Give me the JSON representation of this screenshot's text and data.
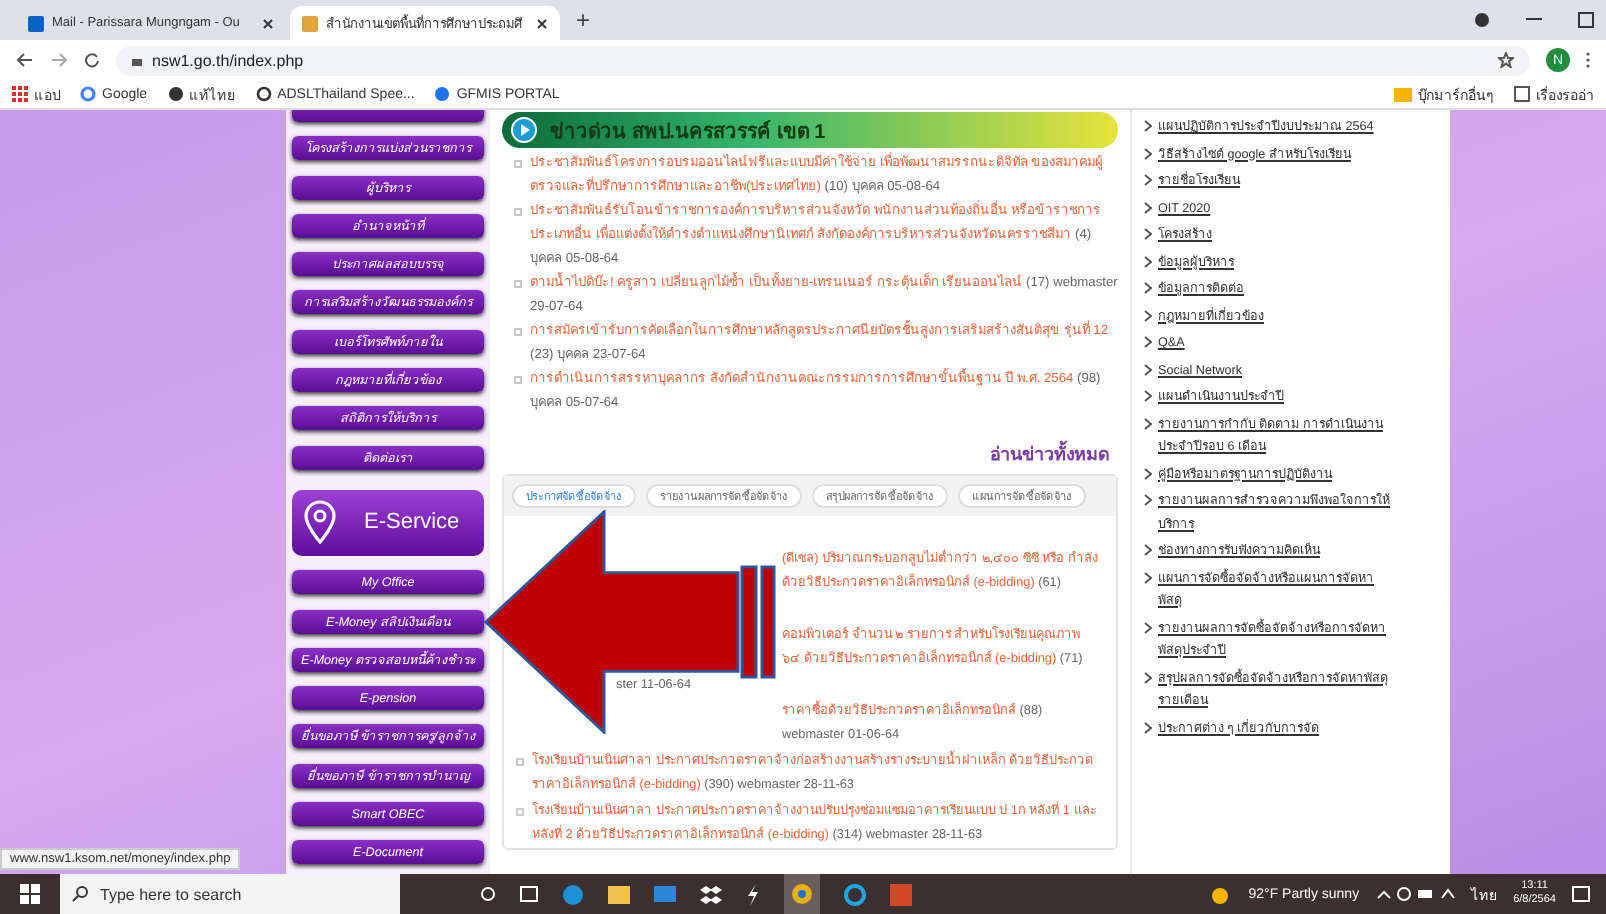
{
  "browser": {
    "tabs": [
      {
        "title": "Mail - Parissara Mungngam - Ou",
        "selected": false
      },
      {
        "title": "สำนักงานเขตพื้นที่การศึกษาประถมศึ",
        "selected": true
      }
    ],
    "new_tab": "+",
    "address": "nsw1.go.th/index.php",
    "profile": "N",
    "bookmarks": [
      {
        "label": "แอป",
        "kind": "apps"
      },
      {
        "label": "Google",
        "kind": "google"
      },
      {
        "label": "แท้ไทย",
        "kind": "globe"
      },
      {
        "label": "ADSLThailand Spee...",
        "kind": "ring"
      },
      {
        "label": "GFMIS PORTAL",
        "kind": "portal"
      }
    ],
    "bookmarks_right": [
      {
        "label": "บุ๊กมาร์กอื่นๆ",
        "kind": "folder"
      },
      {
        "label": "เรื่องรออ่า",
        "kind": "list"
      }
    ]
  },
  "sidebar": {
    "menu": [
      "โครงสร้างการแบ่งส่วนราชการ",
      "ผู้บริหาร",
      "อำนาจหน้าที่",
      "ประกาศผลสอบบรรจุ",
      "การเสริมสร้างวัฒนธรรมองค์กร",
      "เบอร์โทรศัพท์ภายใน",
      "กฎหมายที่เกี่ยวข้อง",
      "สถิติการให้บริการ",
      "ติดต่อเรา"
    ],
    "eservice_title": "E-Service",
    "eservice": [
      "My Office",
      "E-Money สลิปเงินเดือน",
      "E-Money ตรวจสอบหนี้ค้างชำระ",
      "E-pension",
      "ยื่นขอภาษี ข้าราชการครู/ลูกจ้าง",
      "ยื่นขอภาษี ข้าราชการบำนาญ",
      "Smart OBEC",
      "E-Document"
    ]
  },
  "news": {
    "title": "ข่าวด่วน สพป.นครสวรรค์ เขต 1",
    "items": [
      {
        "text": "ประชาสัมพันธ์โครงการอบรมออนไลน์ฟรีและแบบมีค่าใช้จ่าย เพื่อพัฒนาสมรรถนะดิจิทัล ของสมาคมผู้ตรวจและที่ปรึกษาการศึกษาและอาชีพ(ประเทศไทย)",
        "meta": "(10) บุคคล 05-08-64"
      },
      {
        "text": "ประชาสัมพันธ์รับโอนข้าราชการองค์การบริหารส่วนจังหวัด พนักงานส่วนท้องถิ่นอื่น หรือข้าราชการประเภทอื่น เพื่อแต่งตั้งให้ดำรงตำแหน่งศึกษานิเทศก์ สังกัดองค์การบริหารส่วนจังหวัดนครราชสีมา",
        "meta": "(4) บุคคล 05-08-64"
      },
      {
        "text": "ตามน้ำไปดิบ๊ะ! ครูสาว เปลี่ยนลูกไม้ซ้ำ เป็นทั้งยาย-เทรนเนอร์ กระตุ้นเด็ก เรียนออนไลน์",
        "meta": "(17) webmaster 29-07-64"
      },
      {
        "text": "การสมัครเข้ารับการคัดเลือกในการศึกษาหลักสูตรประกาศนียบัตรชั้นสูงการเสริมสร้างสันติสุข รุ่นที่ 12",
        "meta": "(23) บุคคล 23-07-64"
      },
      {
        "text": "การดำเนินการสรรหาบุคลากร สังกัดสำนักงานคณะกรรมการการศึกษาขั้นพื้นฐาน ปี พ.ศ. 2564",
        "meta": "(98) บุคคล 05-07-64"
      }
    ],
    "read_all": "อ่านข่าวทั้งหมด"
  },
  "procurement": {
    "tabs": [
      {
        "label": "ประกาศจัดซื้อจัดจ้าง",
        "selected": true
      },
      {
        "label": "รายงานผลการจัดซื้อจัดจ้าง",
        "selected": false
      },
      {
        "label": "สรุปผลการจัดซื้อจัดจ้าง",
        "selected": false
      },
      {
        "label": "แผนการจัดซื้อจัดจ้าง",
        "selected": false
      }
    ],
    "items": [
      {
        "kind": "partial",
        "lines": [
          "(ดีเซล) ปริมาณกระบอกสูบไม่ต่ำกว่า ๒,๔๐๐ ซีซี หรือ กำลัง",
          "ด้วยวิธีประกวดราคาอิเล็กทรอนิกส์ (e-bidding)"
        ],
        "meta": "(61)"
      },
      {
        "kind": "partial",
        "lines": [
          "คอมพิวเตอร์ จำนวน ๒ รายการ สำหรับโรงเรียนคุณภาพ",
          "๖๔ ด้วยวิธีประกวดราคาอิเล็กทรอนิกส์ (e-bidding)"
        ],
        "meta": "(71)",
        "tail": "ster 11-06-64"
      },
      {
        "kind": "partial",
        "lines": [
          "ราคาซื้อด้วยวิธีประกวดราคาอิเล็กทรอนิกส์"
        ],
        "meta": "(88) webmaster 01-06-64"
      },
      {
        "kind": "full",
        "lines": [
          "โรงเรียนบ้านเนินศาลา ประกาศประกวดราคาจ้างก่อสร้างงานสร้างรางระบายน้ำฝาเหล็ก ด้วยวิธีประกวดราคาอิเล็กทรอนิกส์ (e-bidding)"
        ],
        "meta": "(390) webmaster 28-11-63"
      },
      {
        "kind": "full",
        "lines": [
          "โรงเรียนบ้านเนินศาลา ประกาศประกวดราคาจ้างงานปรับปรุงซ่อมแซมอาคารเรียนแบบ ป 1ก หลังที่ 1 และหลังที่ 2 ด้วยวิธีประกวดราคาอิเล็กทรอนิกส์ (e-bidding)"
        ],
        "meta": "(314) webmaster 28-11-63"
      }
    ]
  },
  "links": [
    "แผนปฏิบัติการประจำปีงบประมาณ 2564",
    "วิธีสร้างไซต์ google สำหรับโรงเรียน",
    "รายชื่อโรงเรียน",
    "OIT 2020",
    "โครงสร้าง",
    "ข้อมูลผู้บริหาร",
    "ข้อมูลการติดต่อ",
    "กฎหมายที่เกี่ยวข้อง",
    "Q&A",
    "Social Network",
    "แผนดำเนินงานประจำปี",
    "รายงานการกำกับ ติดตาม การดำเนินงาน ประจำปีรอบ 6 เดือน",
    "คู่มือหรือมาตรฐานการปฏิบัติงาน",
    "รายงานผลการสำรวจความพึงพอใจการให้บริการ",
    "ช่องทางการรับฟังความคิดเห็น",
    "แผนการจัดซื้อจัดจ้างหรือแผนการจัดหาพัสดุ",
    "รายงานผลการจัดซื้อจัดจ้างหรือการจัดหาพัสดุประจำปี",
    "สรุปผลการจัดซื้อจัดจ้างหรือการจัดหาพัสดุรายเดือน",
    "ประกาศต่าง ๆ เกี่ยวกับการจัด"
  ],
  "status_url": "www.nsw1.ksom.net/money/index.php",
  "taskbar": {
    "search": "Type here to search",
    "weather": "92°F  Partly sunny",
    "language": "ไทย",
    "time": "13:11",
    "date": "6/8/2564"
  }
}
